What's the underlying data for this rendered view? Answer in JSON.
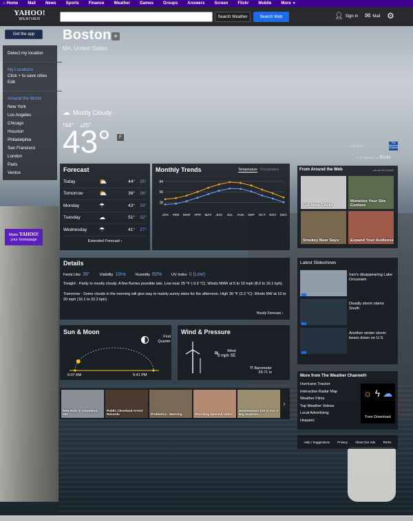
{
  "topnav": {
    "items": [
      "Home",
      "Mail",
      "News",
      "Sports",
      "Finance",
      "Weather",
      "Games",
      "Groups",
      "Answers",
      "Screen",
      "Flickr",
      "Mobile",
      "More"
    ]
  },
  "header": {
    "logo_text": "YAHOO!",
    "logo_sub": "WEATHER",
    "search_weather": "Search Weather",
    "search_web": "Search Web",
    "signin": "Sign In",
    "mail": "Mail"
  },
  "sidebar": {
    "get_app": "Get the app",
    "detect": "Detect my location",
    "my_locations": "My Locations",
    "click_save": "Click + to save cities",
    "edit": "Edit",
    "around_world": "Around the World",
    "cities": [
      "New York",
      "Los Angeles",
      "Chicago",
      "Houston",
      "Philadelphia",
      "San Francisco",
      "London",
      "Paris",
      "Venice"
    ],
    "make_yahoo_1": "Make",
    "make_yahoo_brand": "YAHOO!",
    "make_yahoo_2": "your homepage"
  },
  "location": {
    "city": "Boston",
    "region": "MA, United States",
    "condition": "Mostly Cloudy",
    "high": "44°",
    "low": "25°",
    "current": "43°",
    "unit": "F",
    "credit_1": "Data from",
    "credit_2": "# by katerain on",
    "credit_flickr": "flickr",
    "twc": "The Weather Channel"
  },
  "forecast": {
    "title": "Forecast",
    "days": [
      {
        "day": "Today",
        "icon": "partly-cloudy-night-icon",
        "hi": "44°",
        "lo": "25°"
      },
      {
        "day": "Tomorrow",
        "icon": "partly-cloudy-night-icon",
        "hi": "36°",
        "lo": "26°"
      },
      {
        "day": "Monday",
        "icon": "cloud-rain-icon",
        "hi": "43°",
        "lo": "33°"
      },
      {
        "day": "Tuesday",
        "icon": "cloud-icon",
        "hi": "51°",
        "lo": "32°"
      },
      {
        "day": "Wednesday",
        "icon": "cloud-rain-icon",
        "hi": "41°",
        "lo": "27°"
      }
    ],
    "extended": "Extended Forecast ›"
  },
  "trends": {
    "title": "Monthly Trends",
    "tab_temp": "Temperature",
    "tab_precip": "Precipitation"
  },
  "chart_data": {
    "type": "line",
    "categories": [
      "JAN",
      "FEB",
      "MAR",
      "APR",
      "MAY",
      "JUN",
      "JUL",
      "AUG",
      "SEP",
      "OCT",
      "NOV",
      "DEC"
    ],
    "series": [
      {
        "name": "High",
        "color": "#f5a623",
        "values": [
          36,
          39,
          46,
          56,
          67,
          76,
          82,
          80,
          73,
          62,
          52,
          41
        ]
      },
      {
        "name": "Low",
        "color": "#6ea3ff",
        "values": [
          22,
          24,
          31,
          40,
          50,
          59,
          65,
          64,
          57,
          46,
          38,
          28
        ]
      }
    ],
    "yticks": [
      28,
      56,
      84
    ],
    "ylim": [
      10,
      95
    ],
    "title": "",
    "xlabel": "",
    "ylabel": ""
  },
  "details": {
    "title": "Details",
    "feels_label": "Feels Like",
    "feels_value": "36°",
    "visibility_label": "Visibility",
    "visibility_value": "10mi",
    "humidity_label": "Humidity",
    "humidity_value": "60%",
    "uv_label": "UV Index",
    "uv_value": "0 (Low)",
    "tonight": "Tonight - Partly to mostly cloudy. A few flurries possible late. Low near 25 °F (-3.9 °C). Winds NNW at 5 to 10 mph (8.0 to 16.1 kph).",
    "tomorrow": "Tomorrow - Some clouds in the morning will give way to mainly sunny skies for the afternoon. High 36 °F (2.2 °C). Winds NW at 10 to 20 mph (16.1 to 32.2 kph).",
    "hourly": "Hourly Forecast ›"
  },
  "sunmoon": {
    "title": "Sun & Moon",
    "moon_phase": "First Quarter",
    "sunrise": "6:07 AM",
    "sunset": "5:41 PM",
    "sun_progress": 0.13
  },
  "wind": {
    "title": "Wind & Pressure",
    "wind_label": "Wind",
    "wind_value": "9 mph SE",
    "baro_label": "Barometer",
    "baro_value": "29.71 in"
  },
  "thumbs": [
    {
      "caption": "New Rule in Cleveland, OH",
      "color": "#8a8f96"
    },
    {
      "caption": "Public Cleveland Arrest Records",
      "color": "#4a3a30"
    },
    {
      "caption": "Probiotics - Warning",
      "color": "#7a6a55"
    },
    {
      "caption": "Shocking Spanish Video",
      "color": "#b58a72"
    },
    {
      "caption": "Homeowners Are In For A Big Surprise...",
      "color": "#9a8e6e"
    }
  ],
  "ad": {
    "title": "From Around the Web",
    "ads_by": "ads by RevContent",
    "tiles": [
      {
        "caption": "Get More Clicks",
        "color": "#c8c8c8"
      },
      {
        "caption": "Monetize Your Site Content",
        "color": "#5c6b4d"
      },
      {
        "caption": "Smokey Bear Says:",
        "color": "#7a6850"
      },
      {
        "caption": "Expand Your Audience",
        "color": "#a05a4a"
      }
    ]
  },
  "slides": {
    "title": "Latest Slideshows",
    "items": [
      {
        "caption": "Iran's disappearing Lake Oroumieh",
        "color": "#8f9ea8"
      },
      {
        "caption": "Deadly storm slams South",
        "color": "#2a3844"
      },
      {
        "caption": "Another winter storm bears down on U.S.",
        "color": "#253340"
      }
    ]
  },
  "more_twc": {
    "title": "More from The Weather Channel®",
    "links": [
      "Hurricane Tracker",
      "Interactive Radar Map",
      "Weather Films",
      "Top Weather Videos",
      "Local Advertising",
      "Hispanic"
    ],
    "download": "Free Download"
  },
  "footer": {
    "links": [
      "Help / Suggestions",
      "Privacy",
      "About Our Ads",
      "Terms"
    ]
  }
}
